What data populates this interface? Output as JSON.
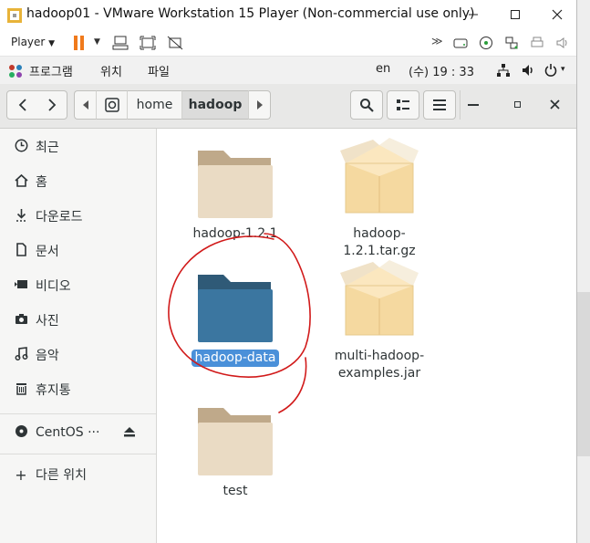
{
  "vmware": {
    "title": "hadoop01 - VMware Workstation 15 Player (Non-commercial use only)",
    "player_label": "Player",
    "window_controls": [
      "minimize-icon",
      "maximize-icon",
      "close-icon"
    ]
  },
  "topbar": {
    "menu_programs": "프로그램",
    "menu_location": "위치",
    "menu_file": "파일",
    "lang": "en",
    "clock": "(수) 19 : 33"
  },
  "header": {
    "crumbs": [
      "home",
      "hadoop"
    ],
    "search_icon": "search-icon",
    "view_icon": "list-view-icon",
    "menu_icon": "hamburger-icon"
  },
  "sidebar": {
    "items": [
      {
        "label": "최근",
        "icon": "clock-icon"
      },
      {
        "label": "홈",
        "icon": "home-icon"
      },
      {
        "label": "다운로드",
        "icon": "download-icon"
      },
      {
        "label": "문서",
        "icon": "document-icon"
      },
      {
        "label": "비디오",
        "icon": "video-icon"
      },
      {
        "label": "사진",
        "icon": "camera-icon"
      },
      {
        "label": "음악",
        "icon": "music-icon"
      },
      {
        "label": "휴지통",
        "icon": "trash-icon"
      }
    ],
    "device": {
      "label": "CentOS ···",
      "icon": "disc-icon",
      "eject": "eject-icon"
    },
    "other": "다른 위치"
  },
  "files": [
    {
      "name": "hadoop-1.2.1",
      "type": "folder"
    },
    {
      "name": "hadoop-1.2.1.tar.gz",
      "type": "archive"
    },
    {
      "name": "hadoop-data",
      "type": "folder",
      "selected": true
    },
    {
      "name": "multi-hadoop-examples.jar",
      "type": "archive",
      "lines": [
        "multi-hadoop-",
        "examples.jar"
      ]
    },
    {
      "name": "test",
      "type": "folder"
    }
  ],
  "colors": {
    "selection": "#4a90d9",
    "annotation": "#d11a1a",
    "pause": "#f07a1c"
  }
}
